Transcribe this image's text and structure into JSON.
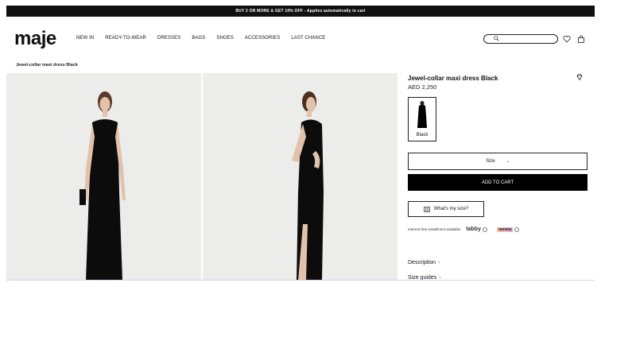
{
  "promo": {
    "text": "BUY 2 OR MORE & GET 10% OFF - Applies automatically in cart"
  },
  "header": {
    "logo": "maje",
    "nav": [
      "NEW IN",
      "READY-TO-WEAR",
      "DRESSES",
      "BAGS",
      "SHOES",
      "ACCESSORIES",
      "LAST CHANCE"
    ],
    "icons": [
      "search-icon",
      "heart-icon",
      "bag-icon"
    ]
  },
  "breadcrumb": "Jewel-collar maxi dress Black",
  "product": {
    "title": "Jewel-collar maxi dress Black",
    "price": "AED 2,250",
    "color_label": "Black",
    "size_label": "Size",
    "add_to_cart": "ADD TO CART",
    "whats_my_size": "What's my size?",
    "installment_text": "Interest-free installment available.",
    "tabby": "tabby",
    "tamara": "tamara",
    "accordion": [
      "Description",
      "Size guides"
    ]
  },
  "colors": {
    "accent": "#000000",
    "promo_bg": "#111111",
    "image_bg": "#ececea"
  }
}
